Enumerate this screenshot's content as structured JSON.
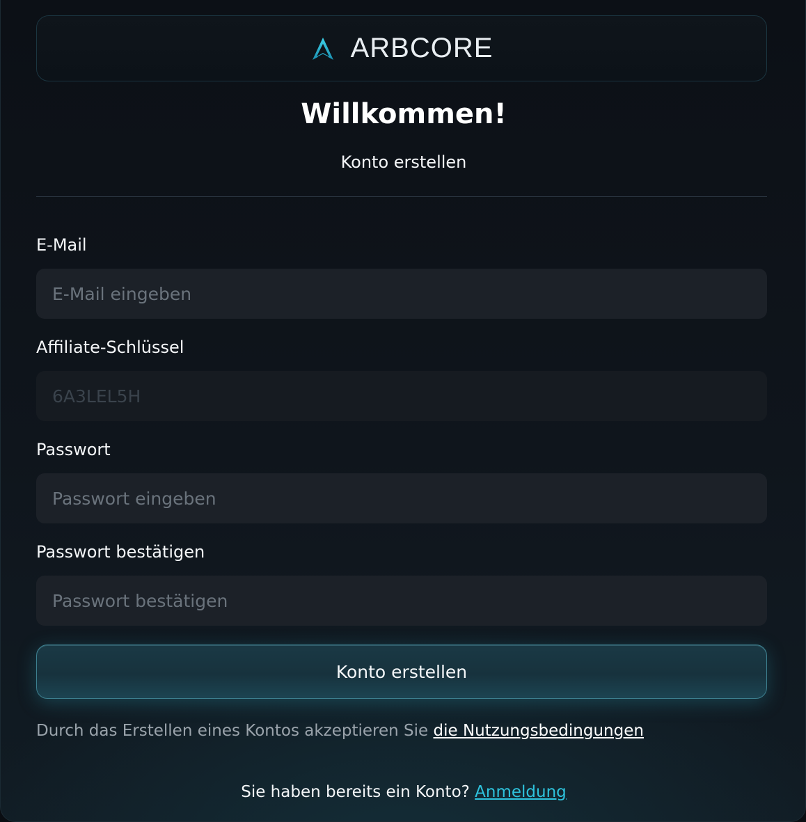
{
  "brand": {
    "name": "ARBCORE",
    "icon": "arbcore-logo-icon",
    "accent_color": "#2ec3dd"
  },
  "header": {
    "title": "Willkommen!",
    "subtitle": "Konto erstellen"
  },
  "form": {
    "email": {
      "label": "E-Mail",
      "placeholder": "E-Mail eingeben",
      "value": ""
    },
    "affiliate": {
      "label": "Affiliate-Schlüssel",
      "value": "6A3LEL5H",
      "disabled": true
    },
    "password": {
      "label": "Passwort",
      "placeholder": "Passwort eingeben",
      "value": ""
    },
    "password_confirm": {
      "label": "Passwort bestätigen",
      "placeholder": "Passwort bestätigen",
      "value": ""
    },
    "submit_label": "Konto erstellen"
  },
  "terms": {
    "text": "Durch das Erstellen eines Kontos akzeptieren Sie ",
    "link_label": "die Nutzungsbedingungen"
  },
  "login": {
    "text": "Sie haben bereits ein Konto? ",
    "link_label": "Anmeldung"
  }
}
